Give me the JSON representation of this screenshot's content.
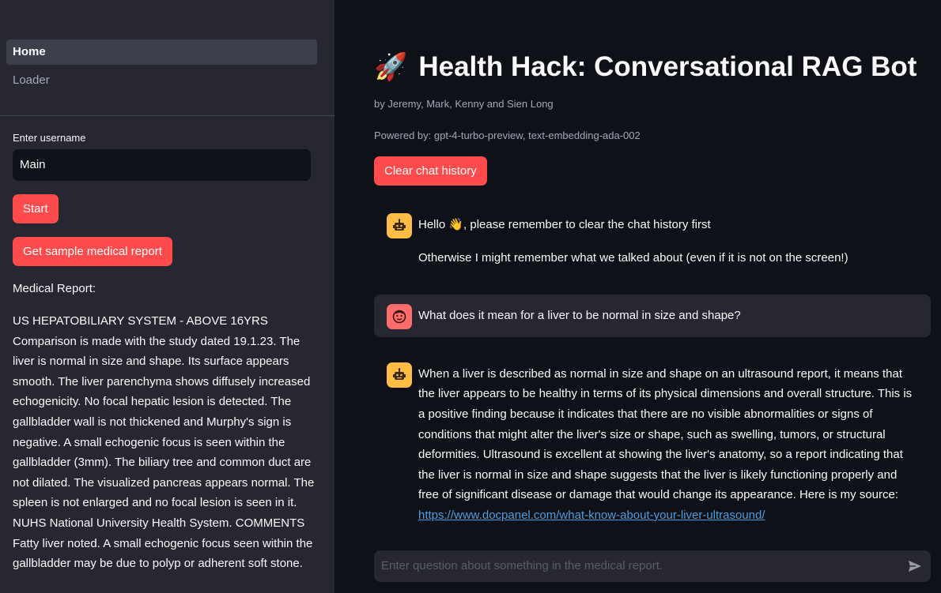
{
  "sidebar": {
    "nav": [
      {
        "label": "Home",
        "active": true
      },
      {
        "label": "Loader",
        "active": false
      }
    ],
    "username_label": "Enter username",
    "username_value": "Main",
    "start_label": "Start",
    "sample_label": "Get sample medical report",
    "report_label": "Medical Report:",
    "report_text": "US HEPATOBILIARY SYSTEM - ABOVE 16YRS Comparison is made with the study dated 19.1.23. The liver is normal in size and shape. Its surface appears smooth. The liver parenchyma shows diffusely increased echogenicity. No focal hepatic lesion is detected. The gallbladder wall is not thickened and Murphy's sign is negative. A small echogenic focus is seen within the gallbladder (3mm). The biliary tree and common duct are not dilated. The visualized pancreas appears normal. The spleen is not enlarged and no focal lesion is seen in it. NUHS National University Health System. COMMENTS Fatty liver noted. A small echogenic focus seen within the gallbladder may be due to polyp or adherent soft stone."
  },
  "main": {
    "title_emoji": "🚀",
    "title": "Health Hack: Conversational RAG Bot",
    "byline": "by Jeremy, Mark, Kenny and Sien Long",
    "powered": "Powered by: gpt-4-turbo-preview, text-embedding-ada-002",
    "clear_label": "Clear chat history",
    "messages": {
      "m1_line1_a": "Hello ",
      "m1_wave": "👋",
      "m1_line1_b": ", please remember to clear the chat history first",
      "m1_line2": "Otherwise I might remember what we talked about (even if it is not on the screen!)",
      "m2": "What does it mean for a liver to be normal in size and shape?",
      "m3": "When a liver is described as normal in size and shape on an ultrasound report, it means that the liver appears to be healthy in terms of its physical dimensions and overall structure. This is a positive finding because it indicates that there are no visible abnormalities or signs of conditions that might alter the liver's size or shape, such as swelling, tumors, or structural deformities. Ultrasound is excellent at showing the liver's anatomy, so a report indicating that the liver is normal in size and shape suggests that the liver is likely functioning properly and free of significant disease or damage that would change its appearance. Here is my source: ",
      "m3_link": "https://www.docpanel.com/what-know-about-your-liver-ultrasound/"
    },
    "input_placeholder": "Enter question about something in the medical report."
  },
  "colors": {
    "accent": "#ff4b4b",
    "sidebar_bg": "#262730",
    "main_bg": "#0e1117",
    "bot_avatar": "#ffbd45",
    "user_avatar": "#ff6c6c",
    "link": "#4d9de0"
  },
  "icons": [
    "robot-icon",
    "face-icon",
    "send-icon"
  ]
}
